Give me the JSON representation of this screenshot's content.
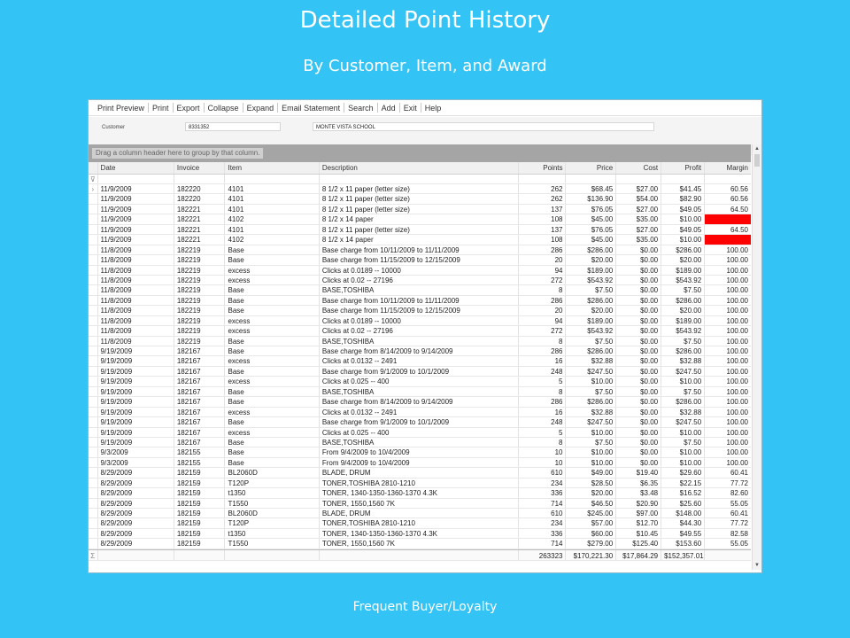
{
  "slide": {
    "title": "Detailed Point History",
    "subtitle": "By Customer, Item, and Award",
    "footer": "Frequent Buyer/Loyalty"
  },
  "menu": [
    "Print Preview",
    "Print",
    "Export",
    "Collapse",
    "Expand",
    "Email Statement",
    "Search",
    "Add",
    "Exit",
    "Help"
  ],
  "customer": {
    "label": "Customer",
    "id": "8331352",
    "name": "MONTE VISTA SCHOOL"
  },
  "grid": {
    "group_hint": "Drag a column header here to group by that column.",
    "columns": [
      "Date",
      "Invoice",
      "Item",
      "Description",
      "Points",
      "Price",
      "Cost",
      "Profit",
      "Margin"
    ],
    "rows": [
      [
        "11/9/2009",
        "182220",
        "4101",
        "8 1/2 x 11 paper (letter size)",
        "262",
        "$68.45",
        "$27.00",
        "$41.45",
        "60.56"
      ],
      [
        "11/9/2009",
        "182220",
        "4101",
        "8 1/2 x 11 paper (letter size)",
        "262",
        "$136.90",
        "$54.00",
        "$82.90",
        "60.56"
      ],
      [
        "11/9/2009",
        "182221",
        "4101",
        "8 1/2 x 11 paper (letter size)",
        "137",
        "$76.05",
        "$27.00",
        "$49.05",
        "64.50"
      ],
      [
        "11/9/2009",
        "182221",
        "4102",
        "8 1/2 x 14 paper",
        "108",
        "$45.00",
        "$35.00",
        "$10.00",
        "22.22"
      ],
      [
        "11/9/2009",
        "182221",
        "4101",
        "8 1/2 x 11 paper (letter size)",
        "137",
        "$76.05",
        "$27.00",
        "$49.05",
        "64.50"
      ],
      [
        "11/9/2009",
        "182221",
        "4102",
        "8 1/2 x 14 paper",
        "108",
        "$45.00",
        "$35.00",
        "$10.00",
        "22.22"
      ],
      [
        "11/8/2009",
        "182219",
        "Base",
        "Base charge from 10/11/2009 to 11/11/2009",
        "286",
        "$286.00",
        "$0.00",
        "$286.00",
        "100.00"
      ],
      [
        "11/8/2009",
        "182219",
        "Base",
        "Base charge from 11/15/2009 to 12/15/2009",
        "20",
        "$20.00",
        "$0.00",
        "$20.00",
        "100.00"
      ],
      [
        "11/8/2009",
        "182219",
        "excess",
        "Clicks at 0.0189 -- 10000",
        "94",
        "$189.00",
        "$0.00",
        "$189.00",
        "100.00"
      ],
      [
        "11/8/2009",
        "182219",
        "excess",
        "Clicks at 0.02 -- 27196",
        "272",
        "$543.92",
        "$0.00",
        "$543.92",
        "100.00"
      ],
      [
        "11/8/2009",
        "182219",
        "Base",
        "BASE,TOSHIBA",
        "8",
        "$7.50",
        "$0.00",
        "$7.50",
        "100.00"
      ],
      [
        "11/8/2009",
        "182219",
        "Base",
        "Base charge from 10/11/2009 to 11/11/2009",
        "286",
        "$286.00",
        "$0.00",
        "$286.00",
        "100.00"
      ],
      [
        "11/8/2009",
        "182219",
        "Base",
        "Base charge from 11/15/2009 to 12/15/2009",
        "20",
        "$20.00",
        "$0.00",
        "$20.00",
        "100.00"
      ],
      [
        "11/8/2009",
        "182219",
        "excess",
        "Clicks at 0.0189 -- 10000",
        "94",
        "$189.00",
        "$0.00",
        "$189.00",
        "100.00"
      ],
      [
        "11/8/2009",
        "182219",
        "excess",
        "Clicks at 0.02 -- 27196",
        "272",
        "$543.92",
        "$0.00",
        "$543.92",
        "100.00"
      ],
      [
        "11/8/2009",
        "182219",
        "Base",
        "BASE,TOSHIBA",
        "8",
        "$7.50",
        "$0.00",
        "$7.50",
        "100.00"
      ],
      [
        "9/19/2009",
        "182167",
        "Base",
        "Base charge from 8/14/2009 to 9/14/2009",
        "286",
        "$286.00",
        "$0.00",
        "$286.00",
        "100.00"
      ],
      [
        "9/19/2009",
        "182167",
        "excess",
        "Clicks at 0.0132 -- 2491",
        "16",
        "$32.88",
        "$0.00",
        "$32.88",
        "100.00"
      ],
      [
        "9/19/2009",
        "182167",
        "Base",
        "Base charge from 9/1/2009 to 10/1/2009",
        "248",
        "$247.50",
        "$0.00",
        "$247.50",
        "100.00"
      ],
      [
        "9/19/2009",
        "182167",
        "excess",
        "Clicks at 0.025 -- 400",
        "5",
        "$10.00",
        "$0.00",
        "$10.00",
        "100.00"
      ],
      [
        "9/19/2009",
        "182167",
        "Base",
        "BASE,TOSHIBA",
        "8",
        "$7.50",
        "$0.00",
        "$7.50",
        "100.00"
      ],
      [
        "9/19/2009",
        "182167",
        "Base",
        "Base charge from 8/14/2009 to 9/14/2009",
        "286",
        "$286.00",
        "$0.00",
        "$286.00",
        "100.00"
      ],
      [
        "9/19/2009",
        "182167",
        "excess",
        "Clicks at 0.0132 -- 2491",
        "16",
        "$32.88",
        "$0.00",
        "$32.88",
        "100.00"
      ],
      [
        "9/19/2009",
        "182167",
        "Base",
        "Base charge from 9/1/2009 to 10/1/2009",
        "248",
        "$247.50",
        "$0.00",
        "$247.50",
        "100.00"
      ],
      [
        "9/19/2009",
        "182167",
        "excess",
        "Clicks at 0.025 -- 400",
        "5",
        "$10.00",
        "$0.00",
        "$10.00",
        "100.00"
      ],
      [
        "9/19/2009",
        "182167",
        "Base",
        "BASE,TOSHIBA",
        "8",
        "$7.50",
        "$0.00",
        "$7.50",
        "100.00"
      ],
      [
        "9/3/2009",
        "182155",
        "Base",
        "From 9/4/2009 to 10/4/2009",
        "10",
        "$10.00",
        "$0.00",
        "$10.00",
        "100.00"
      ],
      [
        "9/3/2009",
        "182155",
        "Base",
        "From 9/4/2009 to 10/4/2009",
        "10",
        "$10.00",
        "$0.00",
        "$10.00",
        "100.00"
      ],
      [
        "8/29/2009",
        "182159",
        "BL2060D",
        "BLADE, DRUM",
        "610",
        "$49.00",
        "$19.40",
        "$29.60",
        "60.41"
      ],
      [
        "8/29/2009",
        "182159",
        "T120P",
        "TONER,TOSHIBA 2810-1210",
        "234",
        "$28.50",
        "$6.35",
        "$22.15",
        "77.72"
      ],
      [
        "8/29/2009",
        "182159",
        "t1350",
        "TONER, 1340-1350-1360-1370 4.3K",
        "336",
        "$20.00",
        "$3.48",
        "$16.52",
        "82.60"
      ],
      [
        "8/29/2009",
        "182159",
        "T1550",
        "TONER, 1550,1560 7K",
        "714",
        "$46.50",
        "$20.90",
        "$25.60",
        "55.05"
      ],
      [
        "8/29/2009",
        "182159",
        "BL2060D",
        "BLADE, DRUM",
        "610",
        "$245.00",
        "$97.00",
        "$148.00",
        "60.41"
      ],
      [
        "8/29/2009",
        "182159",
        "T120P",
        "TONER,TOSHIBA 2810-1210",
        "234",
        "$57.00",
        "$12.70",
        "$44.30",
        "77.72"
      ],
      [
        "8/29/2009",
        "182159",
        "t1350",
        "TONER, 1340-1350-1360-1370 4.3K",
        "336",
        "$60.00",
        "$10.45",
        "$49.55",
        "82.58"
      ],
      [
        "8/29/2009",
        "182159",
        "T1550",
        "TONER, 1550,1560 7K",
        "714",
        "$279.00",
        "$125.40",
        "$153.60",
        "55.05"
      ]
    ],
    "highlight_rows": [
      3,
      5
    ],
    "highlight_color": "#ff0000",
    "totals": {
      "points": "263323",
      "price": "$170,221.30",
      "cost": "$17,864.29",
      "profit": "$152,357.01"
    }
  },
  "colors": {
    "background": "#33c4f5",
    "highlight": "#ff0000"
  }
}
